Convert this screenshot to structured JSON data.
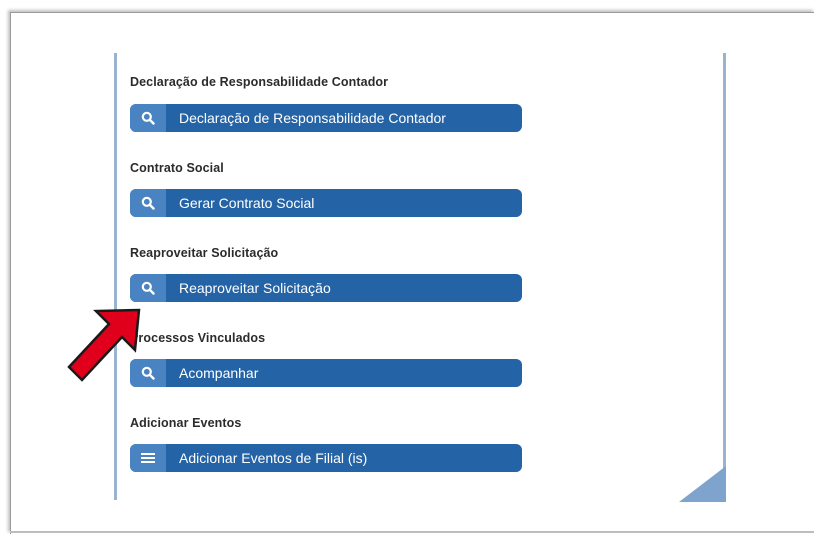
{
  "sections": [
    {
      "title": "Declaração de Responsabilidade Contador",
      "button_label": "Declaração de Responsabilidade Contador",
      "icon": "search-icon"
    },
    {
      "title": "Contrato Social",
      "button_label": "Gerar Contrato Social",
      "icon": "search-icon"
    },
    {
      "title": "Reaproveitar Solicitação",
      "button_label": "Reaproveitar Solicitação",
      "icon": "search-icon"
    },
    {
      "title": "Processos Vinculados",
      "button_label": "Acompanhar",
      "icon": "search-icon"
    },
    {
      "title": "Adicionar Eventos",
      "button_label": "Adicionar Eventos de Filial (is)",
      "icon": "menu-icon"
    }
  ],
  "colors": {
    "button": "#2463a5",
    "icon_box": "#4a83c2",
    "annotation_arrow": "#e0001b"
  }
}
